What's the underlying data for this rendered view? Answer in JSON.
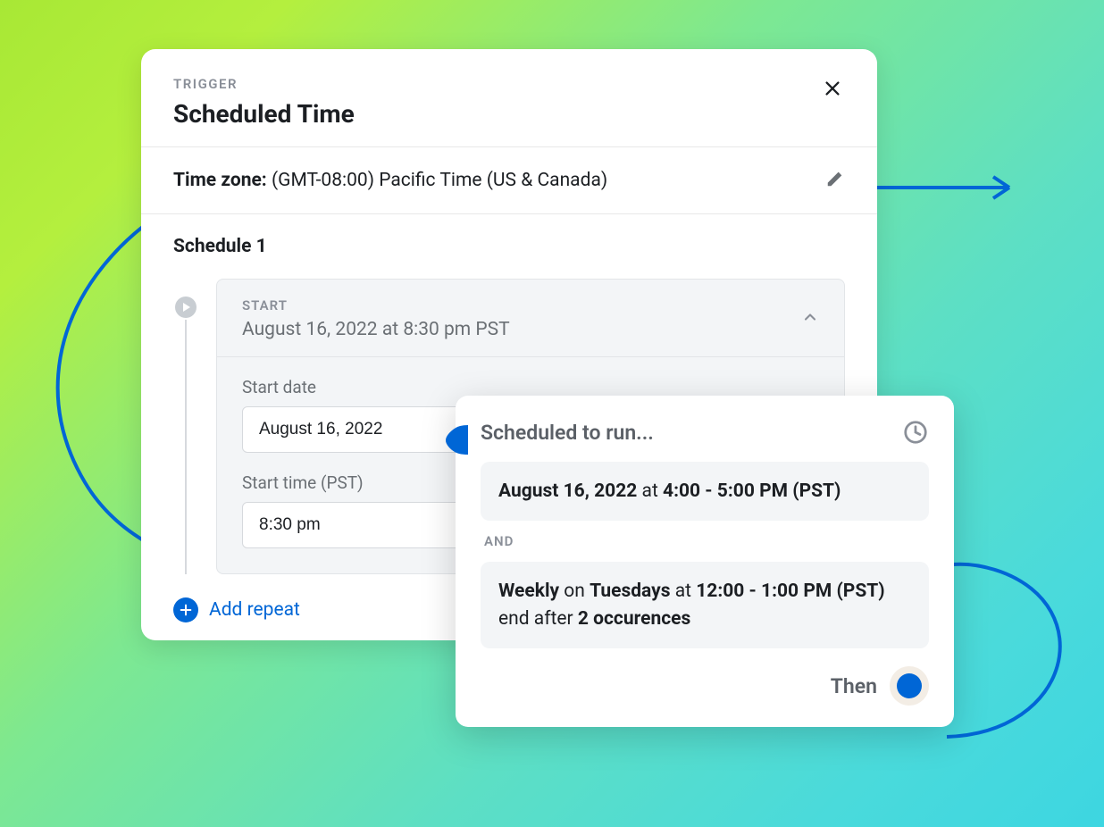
{
  "card": {
    "overline": "TRIGGER",
    "title": "Scheduled Time"
  },
  "timezone": {
    "label": "Time zone:",
    "value": "(GMT-08:00) Pacific Time (US & Canada)"
  },
  "schedule": {
    "title": "Schedule 1",
    "start_overline": "START",
    "start_datetime": "August 16, 2022 at 8:30 pm PST",
    "start_date_label": "Start date",
    "start_date_value": "August 16, 2022",
    "start_time_label": "Start time (PST)",
    "start_time_value": "8:30 pm"
  },
  "add_repeat": "Add repeat",
  "popup": {
    "title": "Scheduled to run...",
    "slot1": {
      "date": "August 16, 2022",
      "at": " at ",
      "time": "4:00 - 5:00 PM (PST)"
    },
    "and": "AND",
    "slot2": {
      "freq": "Weekly",
      "on": " on ",
      "day": "Tuesdays",
      "at": " at ",
      "time": "12:00 - 1:00 PM (PST)",
      "end": " end after ",
      "occur": "2 occurences"
    },
    "then": "Then"
  },
  "colors": {
    "blue": "#0066d6",
    "gray_bg": "#f3f5f7"
  }
}
